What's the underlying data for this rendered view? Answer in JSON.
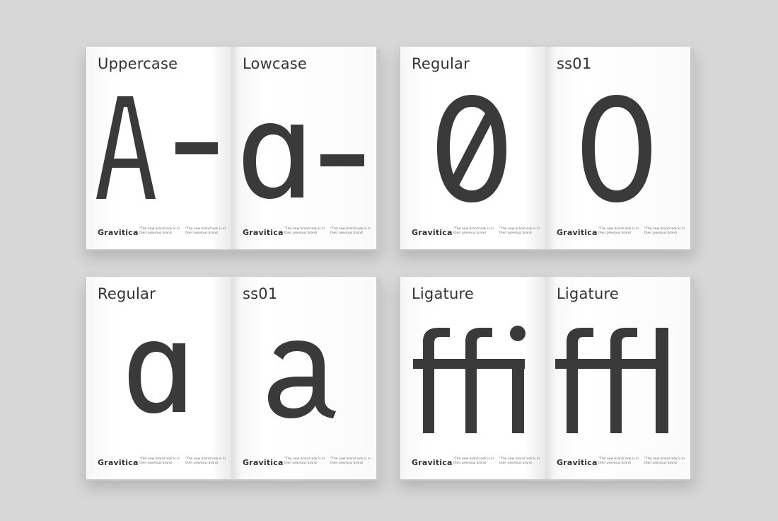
{
  "footer": {
    "brand": "Gravitica",
    "note_1": "\"The new brand look is in their previous brand",
    "note_2": "\"The new brand look is in their previous brand"
  },
  "spreads": [
    {
      "left": {
        "heading": "Uppercase",
        "glyph": "A-"
      },
      "right": {
        "heading": "Lowcase",
        "glyph": "ɑ-"
      }
    },
    {
      "left": {
        "heading": "Regular",
        "glyph": "0"
      },
      "right": {
        "heading": "ss01",
        "glyph": "0"
      }
    },
    {
      "left": {
        "heading": "Regular",
        "glyph": "ɑ"
      },
      "right": {
        "heading": "ss01",
        "glyph": "a"
      }
    },
    {
      "left": {
        "heading": "Ligature",
        "glyph": "ffi"
      },
      "right": {
        "heading": "Ligature",
        "glyph": "ffl"
      }
    }
  ],
  "colors": {
    "background": "#d7d7d7",
    "page": "#ffffff",
    "ink": "#3a3a3a"
  }
}
